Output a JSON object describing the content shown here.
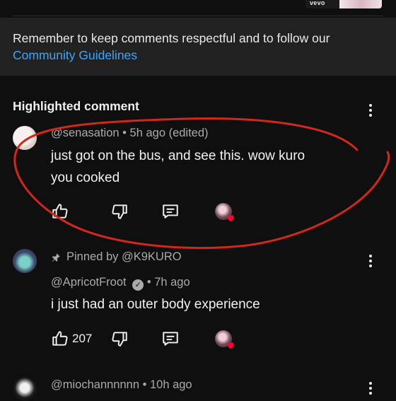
{
  "top": {
    "vevo_label": "vevo"
  },
  "notice": {
    "text": "Remember to keep comments respectful and to follow our",
    "link": "Community Guidelines"
  },
  "highlighted": {
    "title": "Highlighted comment"
  },
  "comments": [
    {
      "handle": "@senasation",
      "time": "5h ago (edited)",
      "text_line1": "just got on the bus, and see this. wow kuro",
      "text_line2": "you cooked",
      "likes": ""
    },
    {
      "pinned_by": "Pinned by @K9KURO",
      "handle": "@ApricotFroot",
      "time": "7h ago",
      "text_line1": "i just had an outer body experience",
      "likes": "207"
    },
    {
      "handle": "@miochannnnnn",
      "time": "10h ago"
    }
  ],
  "colors": {
    "background": "#0f0f0f",
    "banner": "#212121",
    "link": "#3ea6ff",
    "annotation": "#d0281c",
    "heart": "#ff0033"
  },
  "icons": [
    "like-icon",
    "dislike-icon",
    "reply-icon",
    "creator-heart-icon",
    "pin-icon",
    "verified-icon",
    "more-options-icon"
  ]
}
